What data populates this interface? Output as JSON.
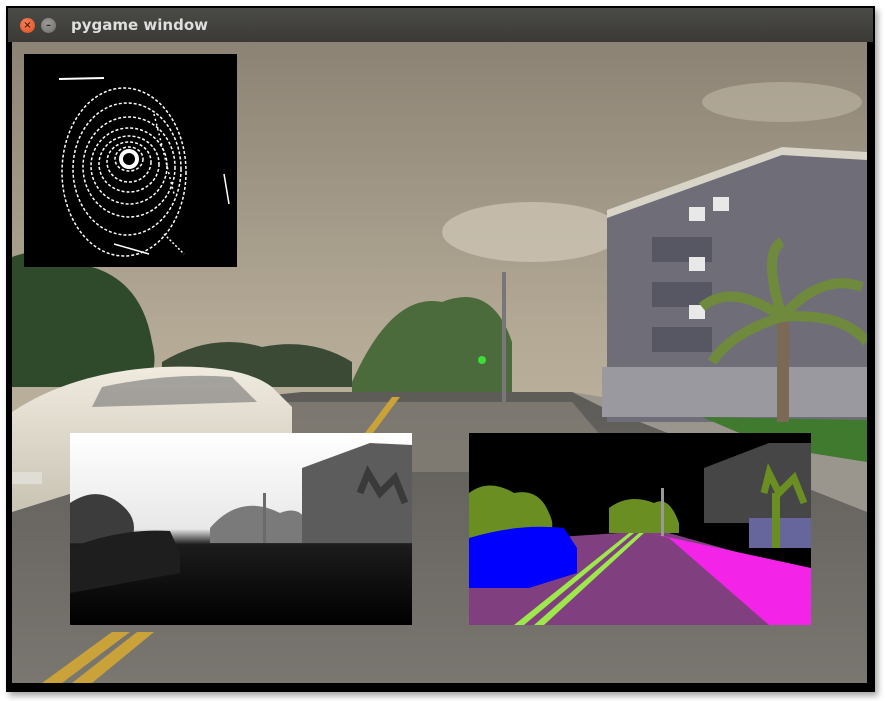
{
  "window": {
    "title": "pygame window",
    "close_symbol": "×",
    "minimize_symbol": "–"
  },
  "views": {
    "main_camera": "rgb-camera-view",
    "lidar": "lidar-top-view",
    "depth": "depth-camera-view",
    "segmentation": "semantic-segmentation-view"
  },
  "colors": {
    "titlebar": "#3c3b37",
    "close_button": "#e95420",
    "seg_sky": "#000000",
    "seg_vegetation": "#6b8e23",
    "seg_vehicle": "#0000ff",
    "seg_road": "#804080",
    "seg_sidewalk": "#f423e8",
    "seg_lane_marking": "#9de84a",
    "seg_building": "#464646",
    "seg_wall": "#66669c",
    "seg_pole": "#999999"
  }
}
